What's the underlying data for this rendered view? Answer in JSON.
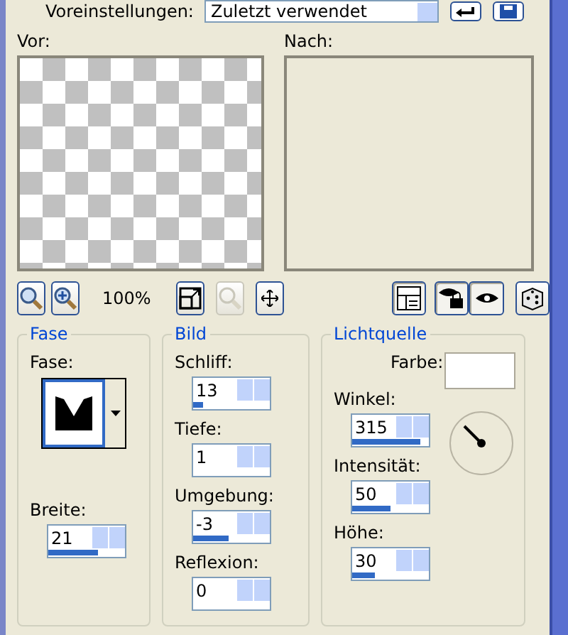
{
  "presets": {
    "label": "Voreinstellungen:",
    "value": "Zuletzt verwendet"
  },
  "previews": [
    {
      "label": "Vor:",
      "kind": "checker"
    },
    {
      "label": "Nach:",
      "kind": "blank"
    }
  ],
  "toolbar": {
    "zoom_text": "100%",
    "buttons": [
      {
        "kind": "zoom-out",
        "disabled": false
      },
      {
        "kind": "zoom-in",
        "disabled": false
      }
    ],
    "tools": [
      {
        "kind": "fit",
        "disabled": false
      },
      {
        "kind": "nozoom",
        "disabled": true
      },
      {
        "kind": "move",
        "disabled": false
      }
    ],
    "right": [
      {
        "kind": "layout",
        "selected": true
      },
      {
        "kind": "eye-lock",
        "selected": true
      },
      {
        "kind": "eye",
        "selected": true
      },
      {
        "kind": "dice",
        "selected": false
      }
    ]
  },
  "groups": [
    {
      "title": "Fase",
      "fase_label": "Fase:",
      "fields": [
        {
          "label": "Breite:",
          "value": "21",
          "level": 0.65
        }
      ]
    },
    {
      "title": "Bild",
      "fields": [
        {
          "label": "Schliff:",
          "value": "13",
          "level": 0.13
        },
        {
          "label": "Tiefe:",
          "value": "1"
        },
        {
          "label": "Umgebung:",
          "value": "-3",
          "level": 0.47
        },
        {
          "label": "Reflexion:",
          "value": "0"
        }
      ]
    },
    {
      "title": "Lichtquelle",
      "color_label": "Farbe:",
      "color": "#ffffff",
      "fields": [
        {
          "label": "Winkel:",
          "value": "315",
          "level": 0.88
        },
        {
          "label": "Intensität:",
          "value": "50",
          "level": 0.5
        },
        {
          "label": "Höhe:",
          "value": "30",
          "level": 0.3
        }
      ]
    }
  ]
}
